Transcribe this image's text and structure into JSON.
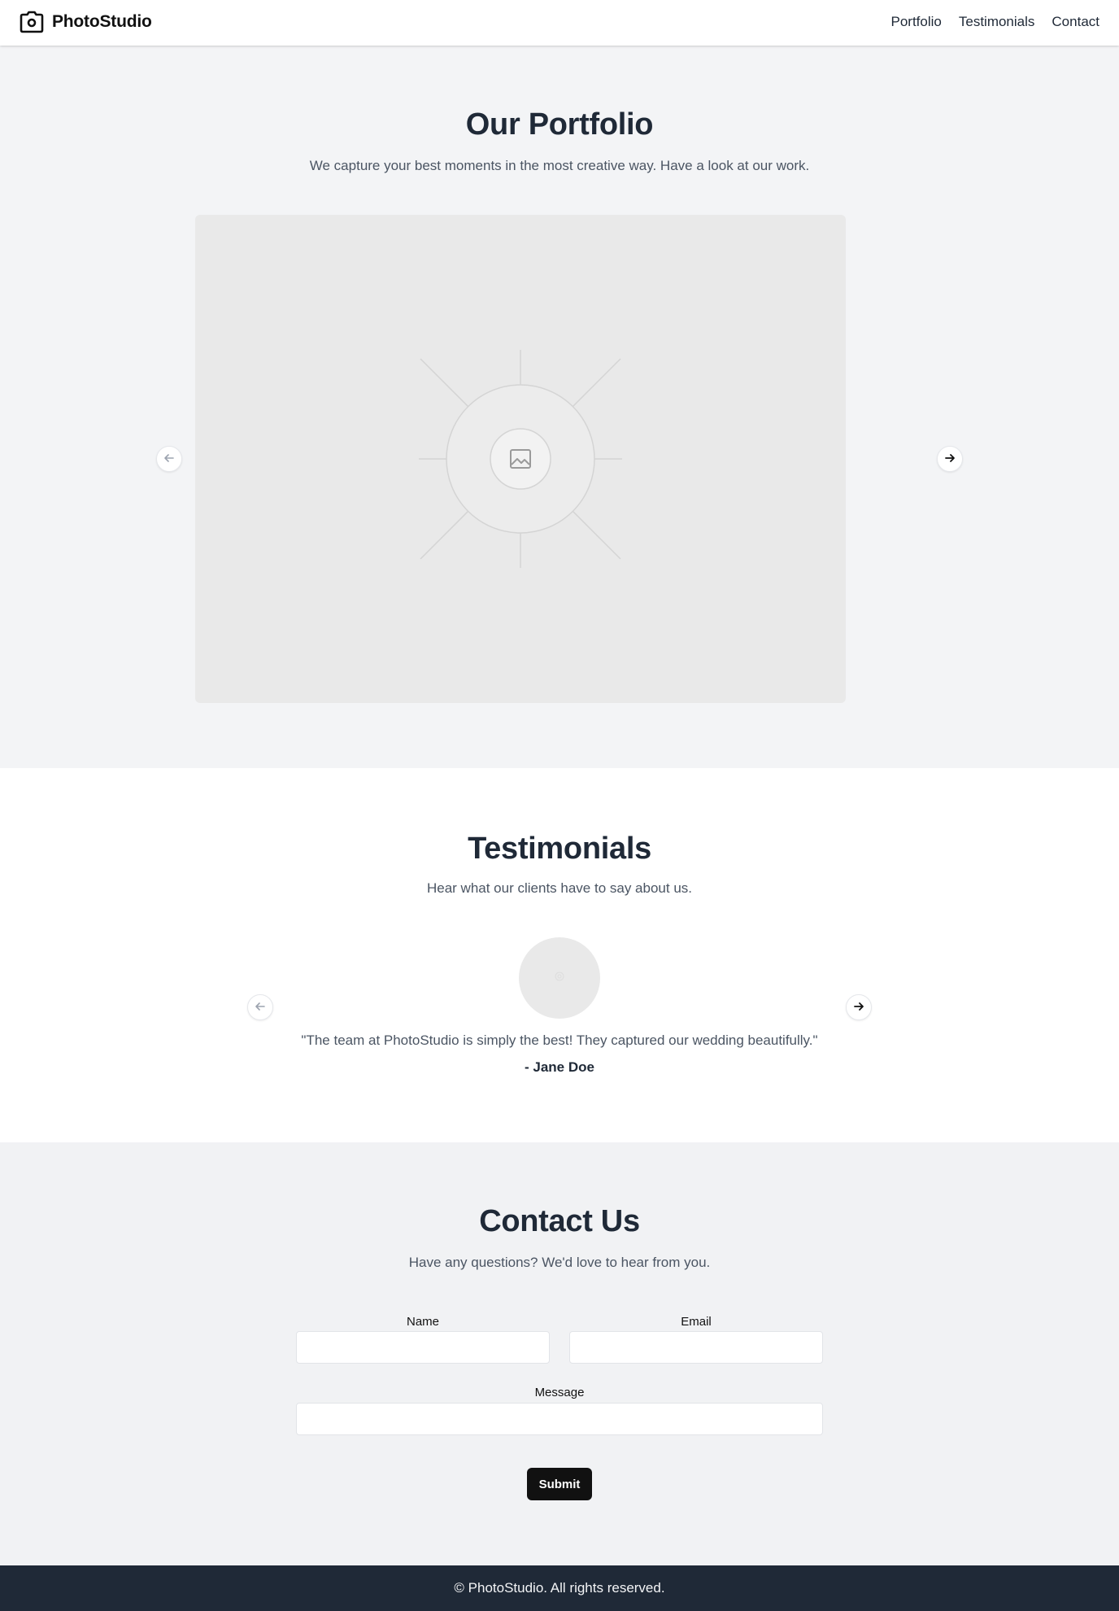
{
  "header": {
    "brand": "PhotoStudio",
    "nav": [
      "Portfolio",
      "Testimonials",
      "Contact"
    ]
  },
  "portfolio": {
    "title": "Our Portfolio",
    "subtitle": "We capture your best moments in the most creative way. Have a look at our work.",
    "slide_image": "image-placeholder-icon"
  },
  "testimonials": {
    "title": "Testimonials",
    "subtitle": "Hear what our clients have to say about us.",
    "quote": "\"The team at PhotoStudio is simply the best! They captured our wedding beautifully.\"",
    "author": "- Jane Doe"
  },
  "contact": {
    "title": "Contact Us",
    "subtitle": "Have any questions? We'd love to hear from you.",
    "name_label": "Name",
    "email_label": "Email",
    "message_label": "Message",
    "name_value": "",
    "email_value": "",
    "message_value": "",
    "submit_label": "Submit"
  },
  "footer": {
    "text": "© PhotoStudio. All rights reserved."
  },
  "colors": {
    "primary_dark": "#1f2937",
    "button": "#111111",
    "page_bg": "#f3f4f6",
    "placeholder": "#e9e9e9"
  }
}
